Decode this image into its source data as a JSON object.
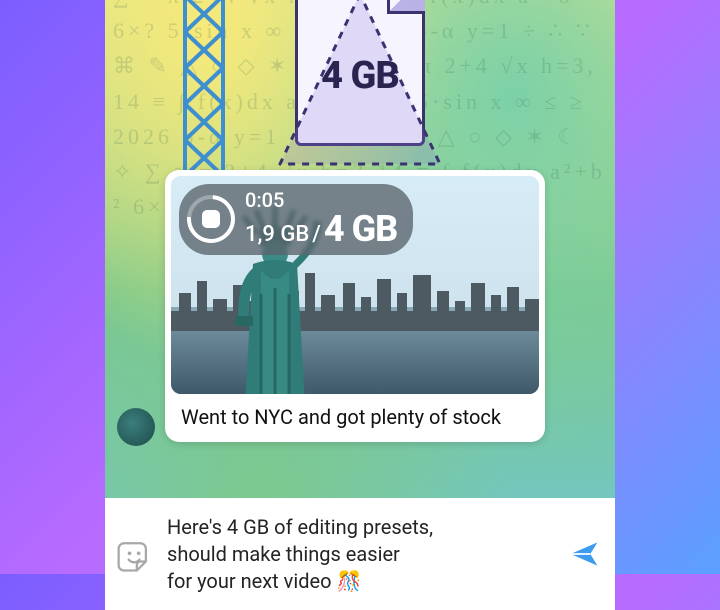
{
  "sticker": {
    "file_size_label": "4 GB"
  },
  "upload": {
    "elapsed": "0:05",
    "done": "1,9 GB",
    "separator": "/",
    "total": "4 GB"
  },
  "message": {
    "caption": "Went to NYC and got plenty of stock"
  },
  "composer": {
    "text": "Here's 4 GB of editing presets, should make things things easier for your next video 🎉",
    "line1": "Here's 4 GB of editing presets,",
    "line2": "should make things easier",
    "line3": "for your next video 🎊"
  },
  "icons": {
    "stop": "stop",
    "sticker": "sticker",
    "send": "send"
  },
  "colors": {
    "accent": "#3e9cf0",
    "bubble": "#ffffff",
    "pill": "rgba(90,100,108,0.78)"
  }
}
